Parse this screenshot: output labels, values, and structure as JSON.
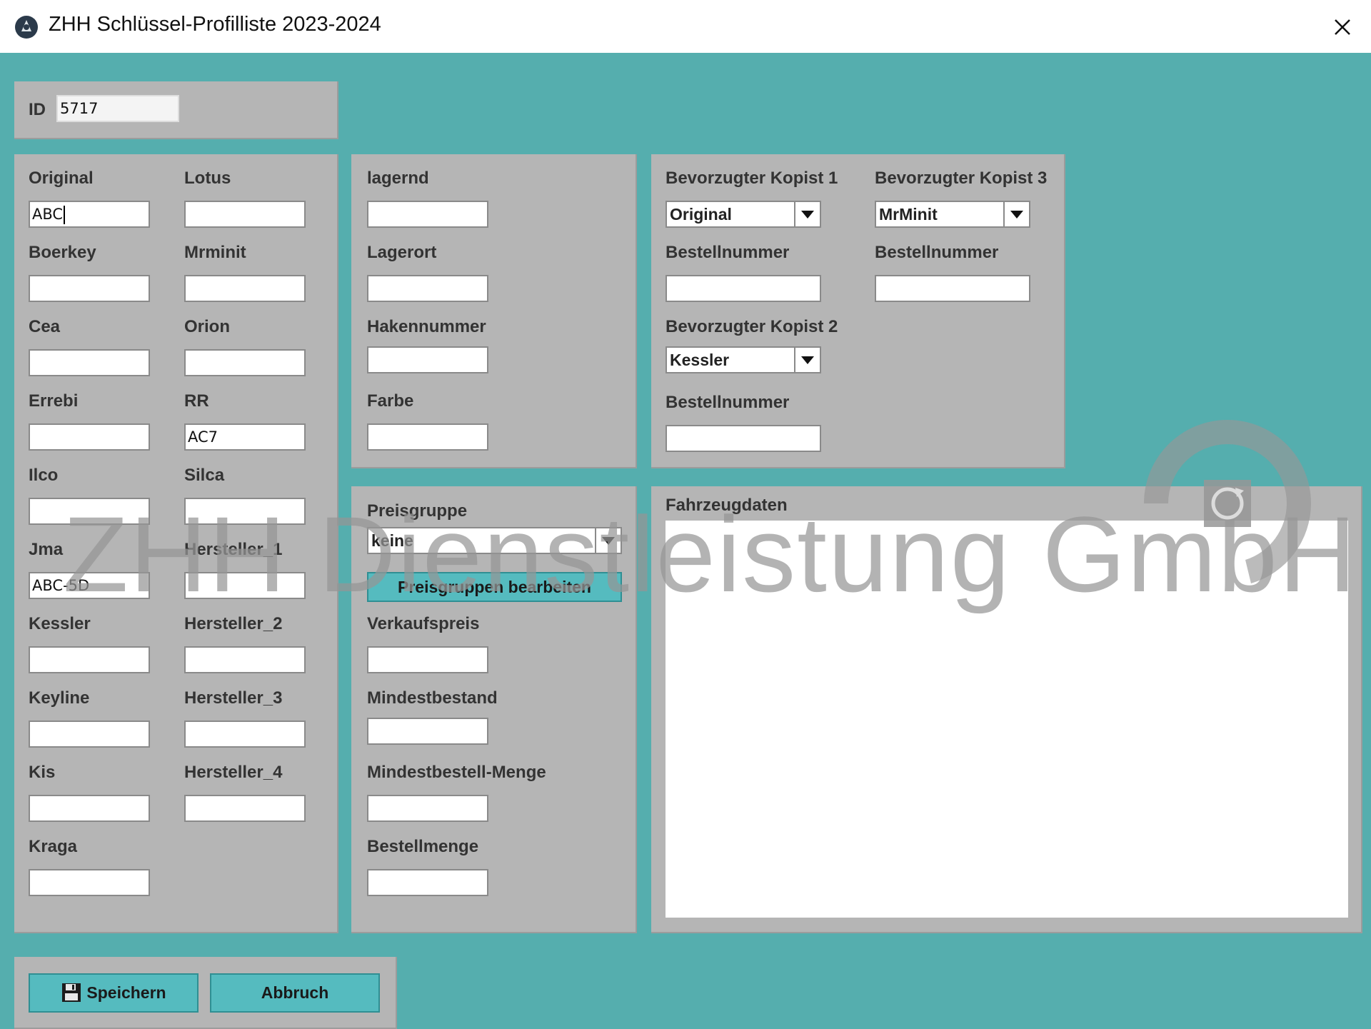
{
  "window": {
    "title": "ZHH Schlüssel-Profilliste 2023-2024"
  },
  "id_section": {
    "label": "ID",
    "value": "5717"
  },
  "profiles": {
    "original": {
      "label": "Original",
      "value": "ABC"
    },
    "lotus": {
      "label": "Lotus",
      "value": ""
    },
    "boerkey": {
      "label": "Boerkey",
      "value": ""
    },
    "mrminit": {
      "label": "Mrminit",
      "value": ""
    },
    "cea": {
      "label": "Cea",
      "value": ""
    },
    "orion": {
      "label": "Orion",
      "value": ""
    },
    "errebi": {
      "label": "Errebi",
      "value": ""
    },
    "rr": {
      "label": "RR",
      "value": "AC7"
    },
    "ilco": {
      "label": "Ilco",
      "value": ""
    },
    "silca": {
      "label": "Silca",
      "value": ""
    },
    "jma": {
      "label": "Jma",
      "value": "ABC-5D"
    },
    "hersteller_1": {
      "label": "Hersteller_1",
      "value": ""
    },
    "kessler": {
      "label": "Kessler",
      "value": ""
    },
    "hersteller_2": {
      "label": "Hersteller_2",
      "value": ""
    },
    "keyline": {
      "label": "Keyline",
      "value": ""
    },
    "hersteller_3": {
      "label": "Hersteller_3",
      "value": ""
    },
    "kis": {
      "label": "Kis",
      "value": ""
    },
    "hersteller_4": {
      "label": "Hersteller_4",
      "value": ""
    },
    "kraga": {
      "label": "Kraga",
      "value": ""
    }
  },
  "stock": {
    "lagernd": {
      "label": "lagernd",
      "value": ""
    },
    "lagerort": {
      "label": "Lagerort",
      "value": ""
    },
    "hakennummer": {
      "label": "Hakennummer",
      "value": ""
    },
    "farbe": {
      "label": "Farbe",
      "value": ""
    }
  },
  "copyists": {
    "k1_label": "Bevorzugter Kopist 1",
    "k1_value": "Original",
    "k1_order_label": "Bestellnummer",
    "k1_order_value": "",
    "k2_label": "Bevorzugter Kopist 2",
    "k2_value": "Kessler",
    "k2_order_label": "Bestellnummer",
    "k2_order_value": "",
    "k3_label": "Bevorzugter Kopist 3",
    "k3_value": "MrMinit",
    "k3_order_label": "Bestellnummer",
    "k3_order_value": ""
  },
  "pricing": {
    "preisgruppe_label": "Preisgruppe",
    "preisgruppe_value": "keine",
    "edit_button": "Preisgruppen bearbeiten",
    "verkaufspreis": {
      "label": "Verkaufspreis",
      "value": ""
    },
    "mindestbestand": {
      "label": "Mindestbestand",
      "value": ""
    },
    "mindestbestellmenge": {
      "label": "Mindestbestell-Menge",
      "value": ""
    },
    "bestellmenge": {
      "label": "Bestellmenge",
      "value": ""
    }
  },
  "vehicle": {
    "label": "Fahrzeugdaten",
    "value": ""
  },
  "actions": {
    "save": "Speichern",
    "cancel": "Abbruch"
  },
  "watermark": {
    "text": "ZHH Dienstleistung GmbH"
  },
  "colors": {
    "background": "#55AEAE",
    "panel": "#B5B5B5",
    "button": "#55BBBF",
    "field": "#FFFFFF"
  },
  "icons": {
    "app": "app-logo-icon",
    "close": "close-icon",
    "save": "floppy-disk-icon",
    "dropdown": "chevron-down-icon"
  }
}
